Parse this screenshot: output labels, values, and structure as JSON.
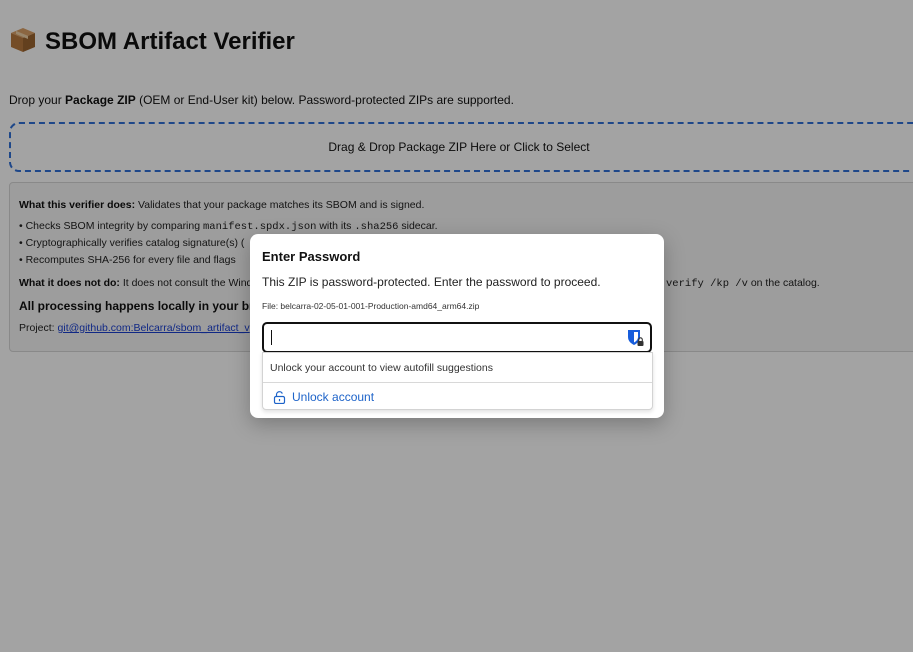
{
  "header": {
    "title": "SBOM Artifact Verifier",
    "icon": "package-icon"
  },
  "intro": {
    "prefix": "Drop your ",
    "bold": "Package ZIP",
    "suffix": " (OEM or End-User kit) below. Password-protected ZIPs are supported."
  },
  "dropzone": {
    "label": "Drag & Drop Package ZIP Here or Click to Select",
    "border_color": "#2f6fd6"
  },
  "info": {
    "does_label": "What this verifier does:",
    "does_text": " Validates that your package matches its SBOM and is signed.",
    "bullet1_prefix": "• Checks SBOM integrity by comparing ",
    "bullet1_code1": "manifest.spdx.json",
    "bullet1_mid": " with its ",
    "bullet1_code2": ".sha256",
    "bullet1_suffix": " sidecar.",
    "bullet2_prefix": "• Cryptographically verifies catalog signature(s) (",
    "bullet3_prefix": "• Recomputes SHA-256 for every file and flags",
    "not_label": "What it does not do:",
    "not_text": " It does not consult the Wind",
    "not_code": "verify /kp /v",
    "not_suffix": " on the catalog.",
    "local_text": "All processing happens locally in your brow",
    "project_label": "Project: ",
    "project_link": "git@github.com:Belcarra/sbom_artifact_v"
  },
  "modal": {
    "title": "Enter Password",
    "description": "This ZIP is password-protected. Enter the password to proceed.",
    "file_label": "File: belcarra-02-05-01-001-Production-amd64_arm64.zip",
    "password_value": "",
    "password_placeholder": "",
    "password_manager_icon": "bitwarden-shield-icon"
  },
  "autofill": {
    "message": "Unlock your account to view autofill suggestions",
    "unlock_label": "Unlock account",
    "unlock_icon": "unlock-icon",
    "link_color": "#1d63c9"
  }
}
